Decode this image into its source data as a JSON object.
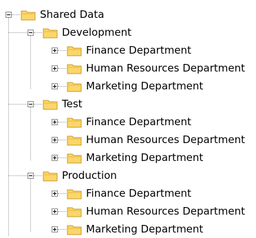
{
  "tree": {
    "root": {
      "label": "Shared Data",
      "groups": [
        {
          "label": "Development",
          "items": [
            "Finance Department",
            "Human Resources Department",
            "Marketing Department"
          ]
        },
        {
          "label": "Test",
          "items": [
            "Finance Department",
            "Human Resources Department",
            "Marketing Department"
          ]
        },
        {
          "label": "Production",
          "items": [
            "Finance Department",
            "Human Resources Department",
            "Marketing Department"
          ]
        }
      ]
    }
  },
  "colors": {
    "folder_fill": "#fbd66a",
    "folder_stroke": "#c79a2b",
    "tree_line": "#9a9a9a"
  }
}
